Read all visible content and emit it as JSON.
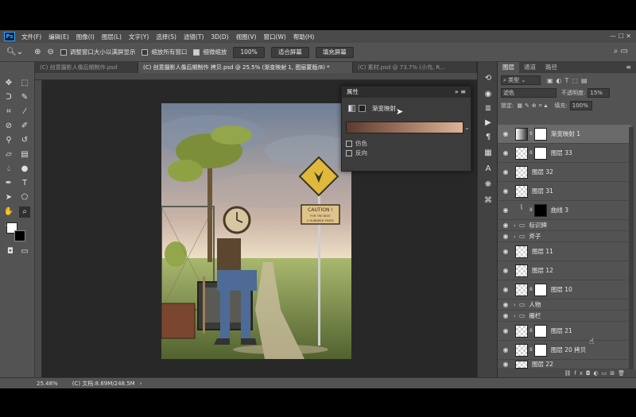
{
  "menu": [
    "文件(F)",
    "编辑(E)",
    "图像(I)",
    "图层(L)",
    "文字(Y)",
    "选择(S)",
    "滤镜(T)",
    "3D(D)",
    "视图(V)",
    "窗口(W)",
    "帮助(H)"
  ],
  "options": {
    "resize_windows": "调整窗口大小以满屏显示",
    "zoom_all": "缩放所有窗口",
    "scrubby_zoom": "细微缩放",
    "zoom_value": "100%",
    "fit_screen": "适合屏幕",
    "fill_screen": "填充屏幕"
  },
  "tabs": [
    "(C) 创意摄影人像后期制作.psd",
    "(C) 创意摄影人像后期制作 拷贝.psd @ 25.5% (渐变映射 1, 图层蒙版/8) *",
    "(C) 素材.psd @ 73.7% (小鸟, R..."
  ],
  "properties": {
    "title": "属性",
    "adjustment": "渐变映射",
    "dither": "仿色",
    "reverse": "反向"
  },
  "artwork": {
    "sign_line1": "CAUTION !",
    "sign_line2": "FOR THE NEXT",
    "sign_line3": "2 HUNDRED YEARS"
  },
  "layers_panel": {
    "tabs": [
      "图层",
      "通道",
      "路径"
    ],
    "filter_kind": "类型",
    "blend_mode": "滤色",
    "opacity_label": "不透明度:",
    "opacity_value": "15%",
    "lock_label": "锁定:",
    "fill_label": "填充:",
    "fill_value": "100%",
    "layers": [
      "渐变映射 1",
      "图层 33",
      "图层 32",
      "图层 31",
      "曲线 3",
      "标识牌",
      "斧子",
      "图层 11",
      "图层 12",
      "图层 10",
      "人物",
      "栅栏",
      "图层 21",
      "图层 20 拷贝",
      "图层 22"
    ]
  },
  "status": {
    "zoom": "25.48%",
    "doc": "(C) 文档:8.69M/248.5M"
  },
  "colors": {
    "accent": "#31a8ff",
    "gradient_start": "#5a3c2f",
    "gradient_end": "#dfb496"
  }
}
